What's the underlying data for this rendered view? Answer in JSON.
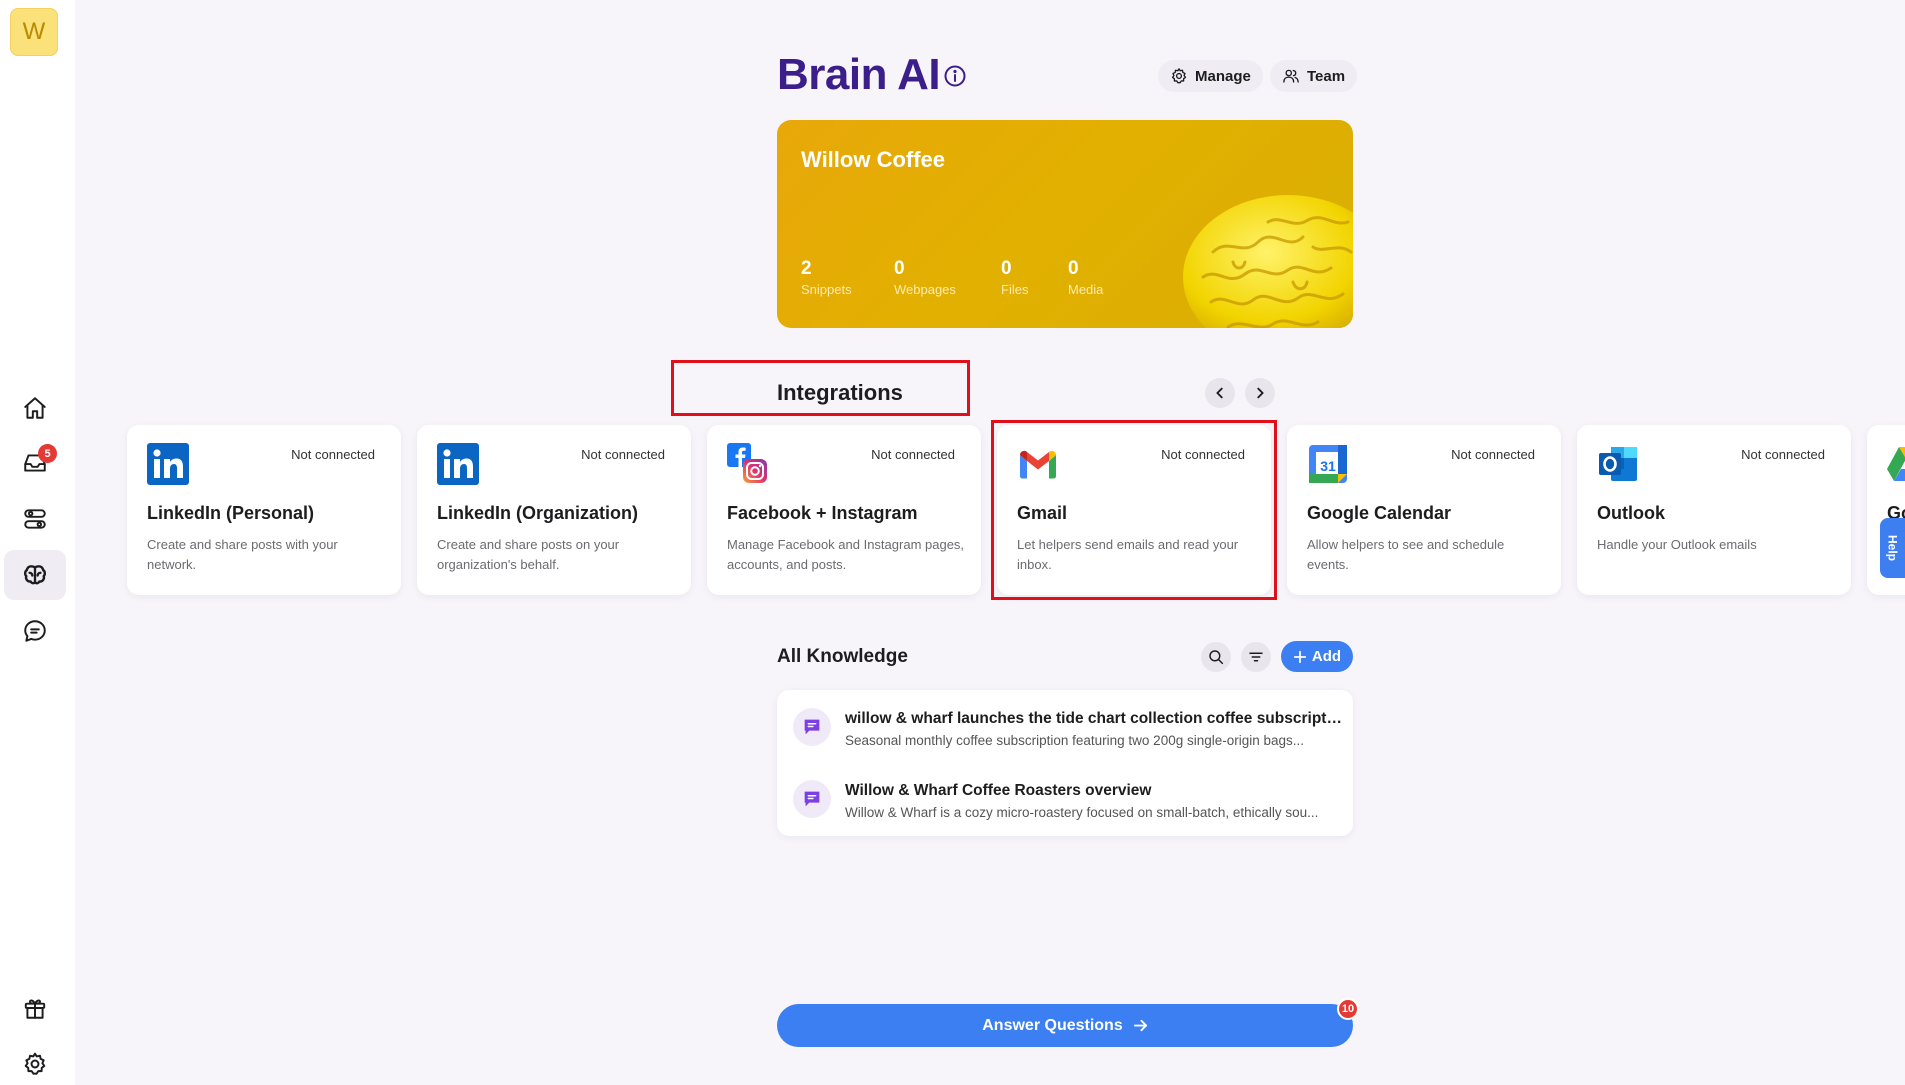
{
  "sidebar": {
    "logo_letter": "W",
    "inbox_badge": "5"
  },
  "header": {
    "title": "Brain AI",
    "manage_label": "Manage",
    "team_label": "Team"
  },
  "banner": {
    "name": "Willow Coffee",
    "stats": [
      {
        "value": "2",
        "label": "Snippets"
      },
      {
        "value": "0",
        "label": "Webpages"
      },
      {
        "value": "0",
        "label": "Files"
      },
      {
        "value": "0",
        "label": "Media"
      }
    ]
  },
  "integrations": {
    "title": "Integrations",
    "cards": [
      {
        "name": "LinkedIn (Personal)",
        "status": "Not connected",
        "desc": "Create and share posts with your network.",
        "icon": "linkedin-icon"
      },
      {
        "name": "LinkedIn (Organization)",
        "status": "Not connected",
        "desc": "Create and share posts on your organization's behalf.",
        "icon": "linkedin-icon"
      },
      {
        "name": "Facebook + Instagram",
        "status": "Not connected",
        "desc": "Manage Facebook and Instagram pages, accounts, and posts.",
        "icon": "facebook-instagram-icon"
      },
      {
        "name": "Gmail",
        "status": "Not connected",
        "desc": "Let helpers send emails and read your inbox.",
        "icon": "gmail-icon"
      },
      {
        "name": "Google Calendar",
        "status": "Not connected",
        "desc": "Allow helpers to see and schedule events.",
        "icon": "google-calendar-icon"
      },
      {
        "name": "Outlook",
        "status": "Not connected",
        "desc": "Handle your Outlook emails",
        "icon": "outlook-icon"
      },
      {
        "name": "Go",
        "status": "",
        "desc": "",
        "icon": "google-drive-icon"
      }
    ],
    "calendar_day": "31",
    "help_label": "Help"
  },
  "knowledge": {
    "title": "All Knowledge",
    "add_label": "Add",
    "items": [
      {
        "title": "willow & wharf launches the tide chart collection coffee subscription",
        "subtitle": "Seasonal monthly coffee subscription featuring two 200g single-origin bags..."
      },
      {
        "title": "Willow & Wharf Coffee Roasters overview",
        "subtitle": "Willow & Wharf is a cozy micro-roastery focused on small-batch, ethically sou..."
      }
    ]
  },
  "footer": {
    "answer_label": "Answer Questions",
    "answer_badge": "10"
  },
  "colors": {
    "title_purple": "#3b1e89",
    "primary_blue": "#3b7ff2",
    "banner_gold": "#e2b000",
    "highlight_red": "#e0101a"
  }
}
